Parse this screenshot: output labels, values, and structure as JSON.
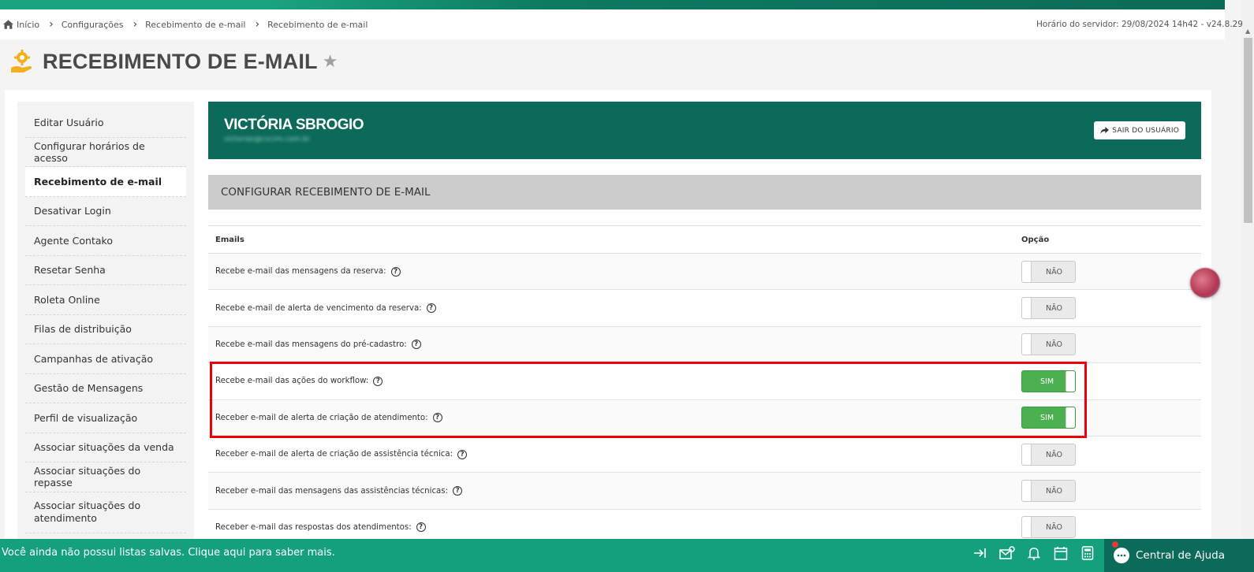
{
  "breadcrumb": [
    "Início",
    "Configurações",
    "Recebimento de e-mail",
    "Recebimento de e-mail"
  ],
  "server_time": "Horário do servidor: 29/08/2024 14h42 - v24.8.29",
  "page": {
    "title": "RECEBIMENTO DE E-MAIL"
  },
  "sidebar": {
    "items": [
      {
        "label": "Editar Usuário"
      },
      {
        "label": "Configurar horários de acesso"
      },
      {
        "label": "Recebimento de e-mail",
        "active": true
      },
      {
        "label": "Desativar Login"
      },
      {
        "label": "Agente Contako"
      },
      {
        "label": "Resetar Senha"
      },
      {
        "label": "Roleta Online"
      },
      {
        "label": "Filas de distribuição"
      },
      {
        "label": "Campanhas de ativação"
      },
      {
        "label": "Gestão de Mensagens"
      },
      {
        "label": "Perfil de visualização"
      },
      {
        "label": "Associar situações da venda"
      },
      {
        "label": "Associar situações do repasse"
      },
      {
        "label": "Associar situações do atendimento"
      }
    ]
  },
  "user": {
    "name": "VICTÓRIA SBROGIO",
    "email": "victorias@cvcrm.com.br",
    "logout_label": "SAIR DO USUÁRIO"
  },
  "section": {
    "title": "CONFIGURAR RECEBIMENTO DE E-MAIL"
  },
  "table": {
    "headers": [
      "Emails",
      "Opção"
    ],
    "rows": [
      {
        "label": "Recebe e-mail das mensagens da reserva:",
        "value": "NÃO",
        "on": false
      },
      {
        "label": "Recebe e-mail de alerta de vencimento da reserva:",
        "value": "NÃO",
        "on": false
      },
      {
        "label": "Recebe e-mail das mensagens do pré-cadastro:",
        "value": "NÃO",
        "on": false
      },
      {
        "label": "Recebe e-mail das ações do workflow:",
        "value": "SIM",
        "on": true
      },
      {
        "label": "Receber e-mail de alerta de criação de atendimento:",
        "value": "SIM",
        "on": true
      },
      {
        "label": "Receber e-mail de alerta de criação de assistência técnica:",
        "value": "NÃO",
        "on": false
      },
      {
        "label": "Receber e-mail das mensagens das assistências técnicas:",
        "value": "NÃO",
        "on": false
      },
      {
        "label": "Receber e-mail das respostas dos atendimentos:",
        "value": "NÃO",
        "on": false
      }
    ]
  },
  "footer": {
    "message": "Você ainda não possui listas salvas. Clique aqui para saber mais.",
    "help_center_label": "Central de Ajuda",
    "icons": [
      "arrow-right-bar-icon",
      "mail-settings-icon",
      "bell-icon",
      "calendar-icon",
      "calculator-icon"
    ]
  },
  "colors": {
    "brand_dark": "#0b6a59",
    "brand_light": "#14a07d",
    "toggle_on": "#4caf50",
    "highlight": "#e8000b"
  }
}
